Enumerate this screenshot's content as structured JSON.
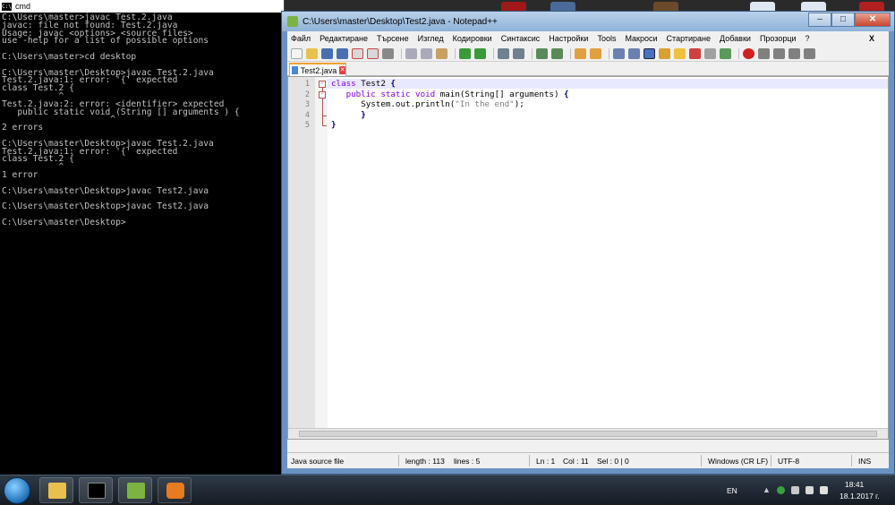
{
  "cmd": {
    "title": "cmd",
    "lines": [
      "C:\\Users\\master>javac Test.2.java",
      "javac: file not found: Test.2.java",
      "Usage: javac <options> <source files>",
      "use -help for a list of possible options",
      "",
      "C:\\Users\\master>cd desktop",
      "",
      "C:\\Users\\master\\Desktop>javac Test.2.java",
      "Test.2.java:1: error: '{' expected",
      "class Test.2 {",
      "           ^",
      "Test.2.java:2: error: <identifier> expected",
      "   public static void (String [] arguments ) {",
      "                     ^",
      "2 errors",
      "",
      "C:\\Users\\master\\Desktop>javac Test.2.java",
      "Test.2.java:1: error: '{' expected",
      "class Test.2 {",
      "           ^",
      "1 error",
      "",
      "C:\\Users\\master\\Desktop>javac Test2.java",
      "",
      "C:\\Users\\master\\Desktop>javac Test2.java",
      "",
      "C:\\Users\\master\\Desktop>"
    ]
  },
  "npp": {
    "title": "C:\\Users\\master\\Desktop\\Test2.java - Notepad++",
    "menu": [
      "Файл",
      "Редактиране",
      "Търсене",
      "Изглед",
      "Кодировки",
      "Синтаксис",
      "Настройки",
      "Tools",
      "Макроси",
      "Стартиране",
      "Добавки",
      "Прозорци",
      "?"
    ],
    "close_x": "X",
    "tab_label": "Test2.java",
    "line_numbers": [
      "1",
      "2",
      "3",
      "4",
      "5"
    ],
    "code": {
      "l1_kw": "class",
      "l1_rest": " Test2 ",
      "l1_brace": "{",
      "l2_indent": "   ",
      "l2_kw": "public static void",
      "l2_rest": " main(String[] arguments) ",
      "l2_brace": "{",
      "l3_pre": "      System.out.println(",
      "l3_str": "\"In the end\"",
      "l3_post": ");",
      "l4_brace": "      }",
      "l5_brace": "}"
    },
    "status": {
      "filetype": "Java source file",
      "length": "length : 113",
      "lines": "lines : 5",
      "ln": "Ln : 1",
      "col": "Col : 11",
      "sel": "Sel : 0 | 0",
      "eol": "Windows (CR LF)",
      "encoding": "UTF-8",
      "mode": "INS"
    }
  },
  "taskbar": {
    "lang": "EN",
    "time": "18:41",
    "date": "18.1.2017 г."
  }
}
